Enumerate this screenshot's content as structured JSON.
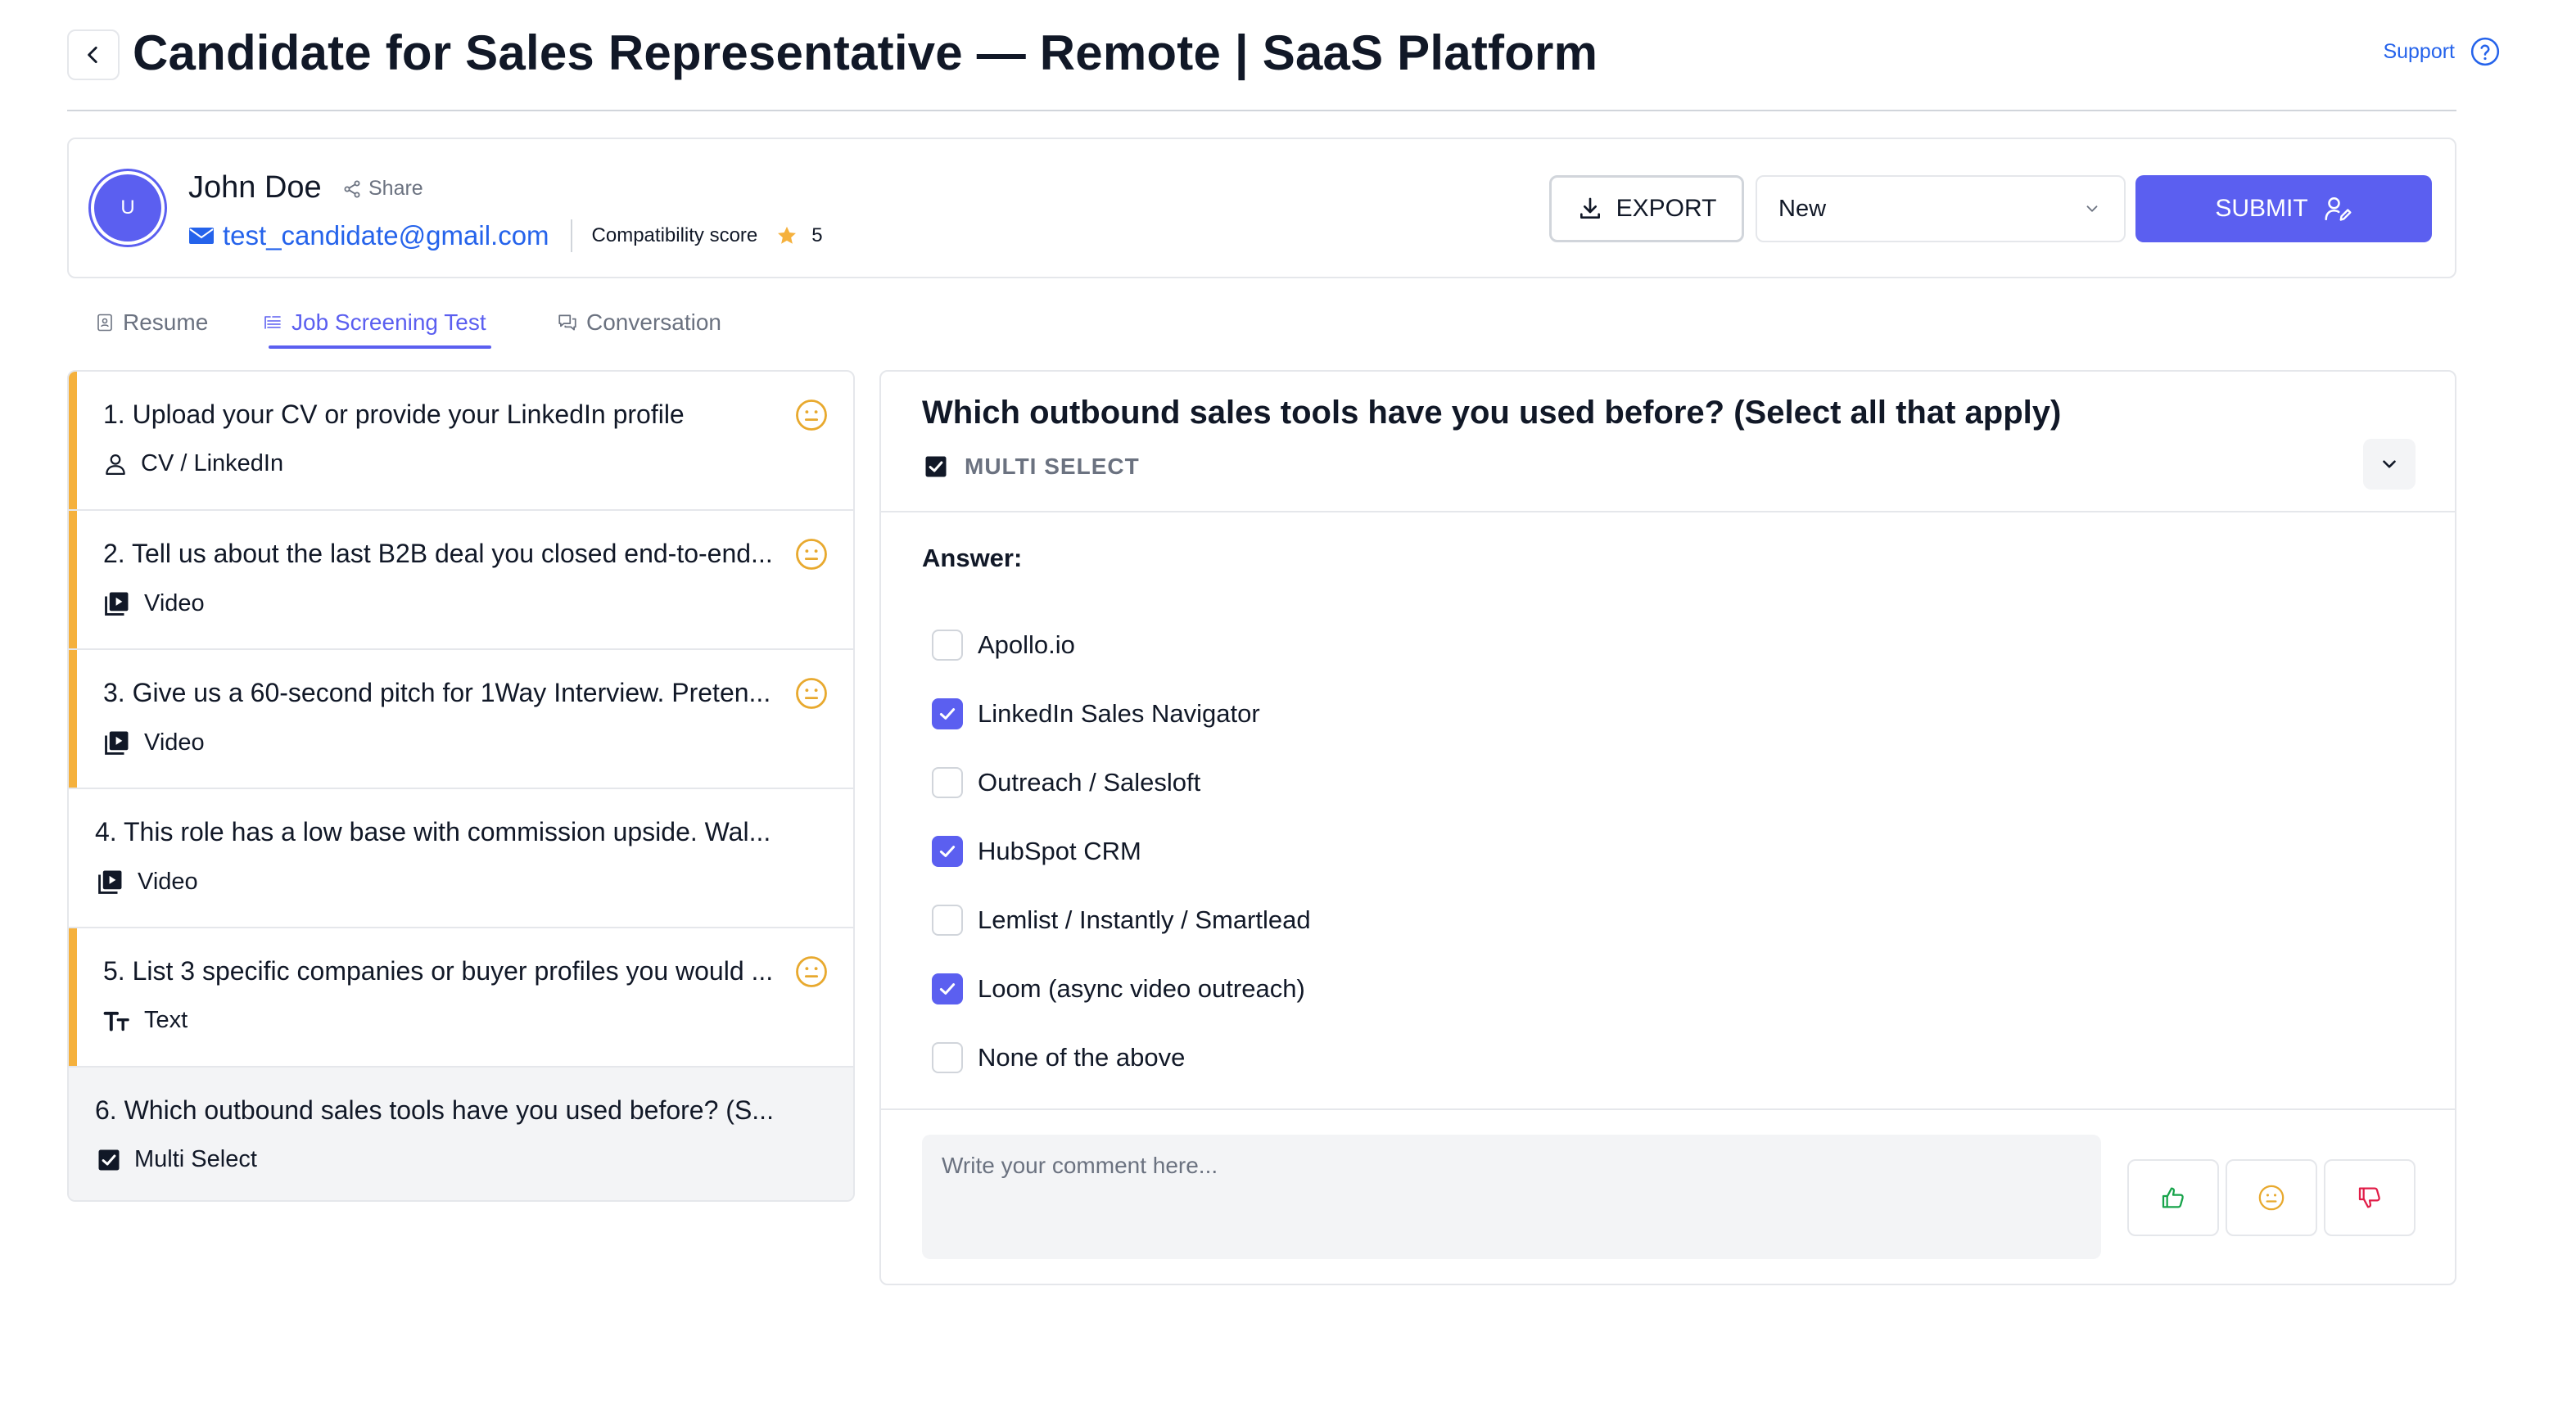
{
  "header": {
    "title": "Candidate for Sales Representative — Remote | SaaS Platform",
    "support_label": "Support"
  },
  "candidate": {
    "avatar_initial": "U",
    "name": "John Doe",
    "share_label": "Share",
    "email": "test_candidate@gmail.com",
    "compat_label": "Compatibility score",
    "compat_score": "5",
    "export_label": "EXPORT",
    "status_value": "New",
    "submit_label": "SUBMIT"
  },
  "tabs": [
    {
      "label": "Resume",
      "active": false
    },
    {
      "label": "Job Screening Test",
      "active": true
    },
    {
      "label": "Conversation",
      "active": false
    }
  ],
  "questions": [
    {
      "title": "1. Upload your CV or provide your LinkedIn profile",
      "type": "CV / LinkedIn",
      "type_icon": "person-icon",
      "flag": true,
      "mood": "neutral"
    },
    {
      "title": "2. Tell us about the last B2B deal you closed end-to-end...",
      "type": "Video",
      "type_icon": "video-icon",
      "flag": true,
      "mood": "neutral"
    },
    {
      "title": "3. Give us a 60-second pitch for 1Way Interview. Preten...",
      "type": "Video",
      "type_icon": "video-icon",
      "flag": true,
      "mood": "neutral"
    },
    {
      "title": "4. This role has a low base with commission upside. Wal...",
      "type": "Video",
      "type_icon": "video-icon",
      "flag": false,
      "mood": ""
    },
    {
      "title": "5. List 3 specific companies or buyer profiles you would ...",
      "type": "Text",
      "type_icon": "text-icon",
      "flag": true,
      "mood": "neutral"
    },
    {
      "title": "6. Which outbound sales tools have you used before? (S...",
      "type": "Multi Select",
      "type_icon": "checkbox-icon",
      "flag": false,
      "mood": "",
      "active": true
    }
  ],
  "answer_panel": {
    "question": "Which outbound sales tools have you used before? (Select all that apply)",
    "type_label": "MULTI SELECT",
    "answer_label": "Answer:",
    "options": [
      {
        "label": "Apollo.io",
        "checked": false
      },
      {
        "label": "LinkedIn Sales Navigator",
        "checked": true
      },
      {
        "label": "Outreach / Salesloft",
        "checked": false
      },
      {
        "label": "HubSpot CRM",
        "checked": true
      },
      {
        "label": "Lemlist / Instantly / Smartlead",
        "checked": false
      },
      {
        "label": "Loom (async video outreach)",
        "checked": true
      },
      {
        "label": "None of the above",
        "checked": false
      }
    ],
    "comment_placeholder": "Write your comment here..."
  },
  "colors": {
    "accent": "#5b5ff0",
    "link": "#2563eb",
    "flag": "#f5b13d",
    "neutral_face": "#e8a92e",
    "thumb_up": "#16a34a",
    "thumb_down": "#e11d48"
  }
}
